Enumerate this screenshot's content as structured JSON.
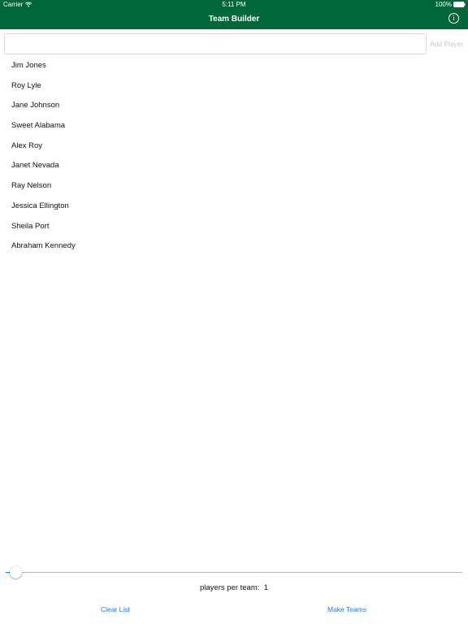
{
  "status_bar": {
    "carrier": "Carrier",
    "time": "5:11 PM",
    "battery": "100%"
  },
  "nav": {
    "title": "Team Builder",
    "info_glyph": "i",
    "background": "#00673a"
  },
  "add_player": {
    "input_value": "",
    "input_placeholder": "",
    "button_label": "Add Player"
  },
  "players": [
    "Jim Jones",
    "Roy Lyle",
    "Jane Johnson",
    "Sweet Alabama",
    "Alex Roy",
    "Janet Nevada",
    "Ray Nelson",
    "Jessica Ellington",
    "Sheila Port",
    "Abraham Kennedy"
  ],
  "team_size": {
    "label": "players per team:",
    "value": "1",
    "slider_fraction": 0
  },
  "actions": {
    "clear_label": "Clear List",
    "make_label": "Make Teams"
  },
  "icons": {
    "wifi": "wifi-icon",
    "battery": "battery-icon",
    "info": "info-icon"
  },
  "colors": {
    "accent": "#1d7bea",
    "slider_fill": "#007aff"
  }
}
